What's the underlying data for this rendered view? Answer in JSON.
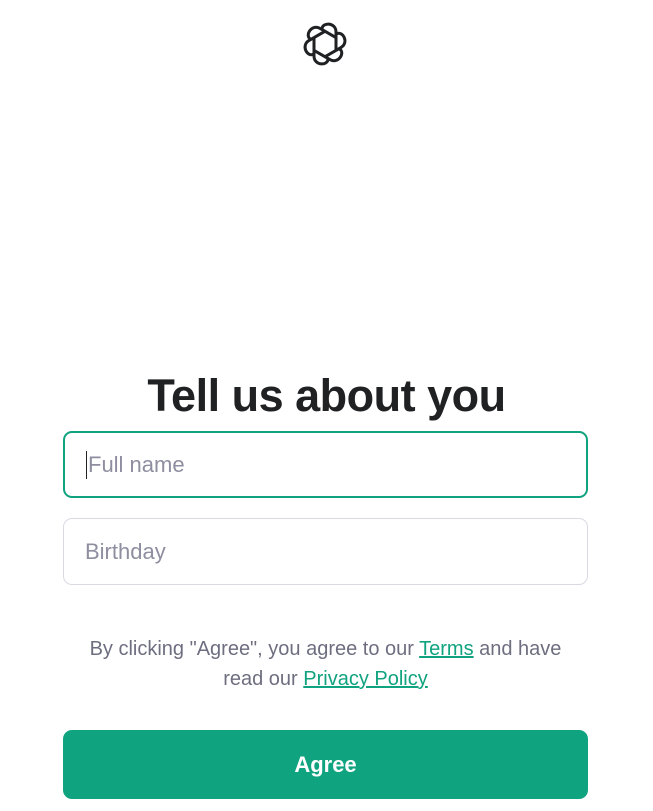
{
  "brand": {
    "logo_icon": "openai-logo-icon",
    "accent_color": "#10a37f"
  },
  "heading": {
    "title": "Tell us about you"
  },
  "form": {
    "full_name": {
      "placeholder": "Full name",
      "value": "",
      "focused": true
    },
    "birthday": {
      "placeholder": "Birthday",
      "value": ""
    }
  },
  "consent": {
    "text_before": "By clicking \"Agree\", you agree to our ",
    "terms_link": "Terms",
    "text_middle": " and have read our ",
    "privacy_link": "Privacy Policy"
  },
  "actions": {
    "agree_label": "Agree"
  }
}
